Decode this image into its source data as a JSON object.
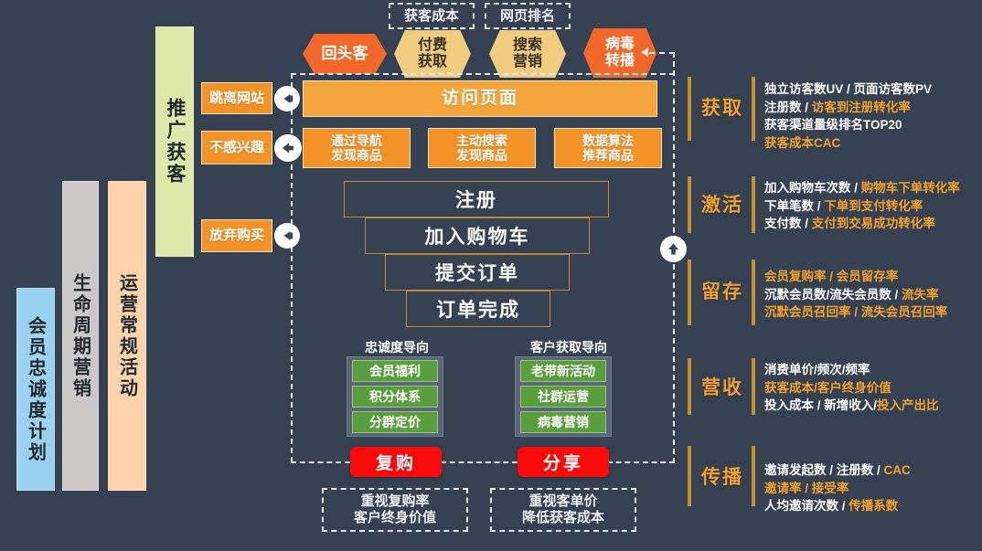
{
  "colors": {
    "background": "#364152",
    "orange": "#f39227",
    "orange_light": "#f4a63c",
    "hex_orange": "#f2682a",
    "hex_sand": "#f0cc80",
    "green": "#5a9e3f",
    "red": "#fa0b0b",
    "gold": "#f0a22e",
    "gold_bar": "#c08f35",
    "bar_blue": "#9ad2f0",
    "bar_gray": "#cbc9c7",
    "bar_peach": "#fbd3ac",
    "bar_green": "#dfe8ab"
  },
  "left_bars": [
    {
      "label": "会员忠诚度计划",
      "color": "#9ad2f0"
    },
    {
      "label": "生命周期营销",
      "color": "#cbc9c7"
    },
    {
      "label": "运营常规活动",
      "color": "#fbd3ac"
    }
  ],
  "promo_bar": {
    "label": "推广获客",
    "color": "#dfe8ab"
  },
  "top_notes": [
    {
      "label": "获客成本"
    },
    {
      "label": "网页排名"
    }
  ],
  "channels": [
    {
      "label": "回头客",
      "style": "orange"
    },
    {
      "label": "付费\n获取",
      "line1": "付费",
      "line2": "获取",
      "style": "sand"
    },
    {
      "label": "搜索\n营销",
      "line1": "搜索",
      "line2": "营销",
      "style": "sand"
    },
    {
      "label": "病毒\n转播",
      "line1": "病毒",
      "line2": "转播",
      "style": "orange"
    }
  ],
  "exit_boxes": [
    {
      "label": "跳离网站"
    },
    {
      "label": "不感兴趣"
    },
    {
      "label": "放弃购买"
    }
  ],
  "visit_bar": {
    "label": "访问页面"
  },
  "discovery_boxes": [
    {
      "line1": "通过导航",
      "line2": "发现商品"
    },
    {
      "line1": "主动搜索",
      "line2": "发现商品"
    },
    {
      "line1": "数据算法",
      "line2": "推荐商品"
    }
  ],
  "funnel": [
    {
      "label": "注册"
    },
    {
      "label": "加入购物车"
    },
    {
      "label": "提交订单"
    },
    {
      "label": "订单完成"
    }
  ],
  "loyalty_group": {
    "heading": "忠诚度导向",
    "items": [
      "会员福利",
      "积分体系",
      "分群定价"
    ],
    "button": "复购",
    "note_line1": "重视复购率",
    "note_line2": "客户终身价值"
  },
  "acquisition_group": {
    "heading": "客户获取导向",
    "items": [
      "老带新活动",
      "社群运营",
      "病毒营销"
    ],
    "button": "分享",
    "note_line1": "重视客单价",
    "note_line2": "降低获客成本"
  },
  "stages": [
    {
      "label": "获取",
      "rows": [
        [
          {
            "t": "独立访客数UV / 页面访客数PV",
            "c": "w"
          }
        ],
        [
          {
            "t": "注册数 / ",
            "c": "w"
          },
          {
            "t": "访客到注册转化率",
            "c": "o"
          }
        ],
        [
          {
            "t": "获客渠道量级排名TOP20",
            "c": "w"
          }
        ],
        [
          {
            "t": "获客成本CAC",
            "c": "o"
          }
        ]
      ]
    },
    {
      "label": "激活",
      "rows": [
        [
          {
            "t": "加入购物车次数 / ",
            "c": "w"
          },
          {
            "t": "购物车下单转化率",
            "c": "o"
          }
        ],
        [
          {
            "t": "下单笔数 / ",
            "c": "w"
          },
          {
            "t": "下单到支付转化率",
            "c": "o"
          }
        ],
        [
          {
            "t": "支付数 / ",
            "c": "w"
          },
          {
            "t": "支付到交易成功转化率",
            "c": "o"
          }
        ]
      ]
    },
    {
      "label": "留存",
      "rows": [
        [
          {
            "t": "会员复购率 / 会员留存率",
            "c": "o"
          }
        ],
        [
          {
            "t": "沉默会员数/流失会员数 / ",
            "c": "w"
          },
          {
            "t": "流失率",
            "c": "o"
          }
        ],
        [
          {
            "t": "沉默会员召回率 / 流失会员召回率",
            "c": "o"
          }
        ]
      ]
    },
    {
      "label": "营收",
      "rows": [
        [
          {
            "t": "消费单价/频次/频率",
            "c": "w"
          }
        ],
        [
          {
            "t": "获客成本/客户终身价值",
            "c": "o"
          }
        ],
        [
          {
            "t": "投入成本 / 新增收入/",
            "c": "w"
          },
          {
            "t": "投入产出比",
            "c": "o"
          }
        ]
      ]
    },
    {
      "label": "传播",
      "rows": [
        [
          {
            "t": "邀请发起数 / 注册数 / ",
            "c": "w"
          },
          {
            "t": "CAC",
            "c": "o"
          }
        ],
        [
          {
            "t": "邀请率 / 接受率",
            "c": "o"
          }
        ],
        [
          {
            "t": "人均邀请次数 / ",
            "c": "w"
          },
          {
            "t": "传播系数",
            "c": "o"
          }
        ]
      ]
    }
  ]
}
